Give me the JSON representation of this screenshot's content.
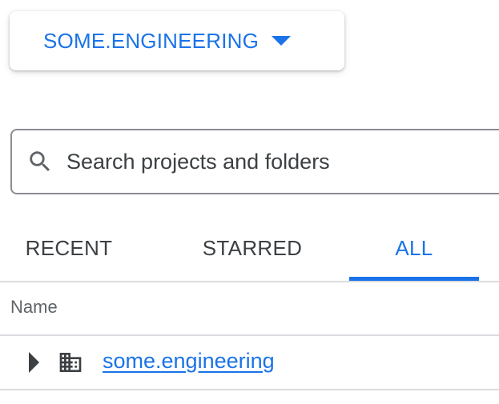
{
  "org_selector": {
    "label": "SOME.ENGINEERING",
    "icon": "caret-down-icon",
    "accent_color": "#1a73e8"
  },
  "search": {
    "placeholder": "Search projects and folders",
    "value": "",
    "icon": "search-icon"
  },
  "tabs": [
    {
      "label": "RECENT",
      "active": false
    },
    {
      "label": "STARRED",
      "active": false
    },
    {
      "label": "ALL",
      "active": true
    }
  ],
  "table": {
    "columns": [
      "Name"
    ],
    "rows": [
      {
        "name": "some.engineering",
        "type_icon": "organization-building-icon",
        "expand_icon": "expand-arrow-icon"
      }
    ]
  }
}
